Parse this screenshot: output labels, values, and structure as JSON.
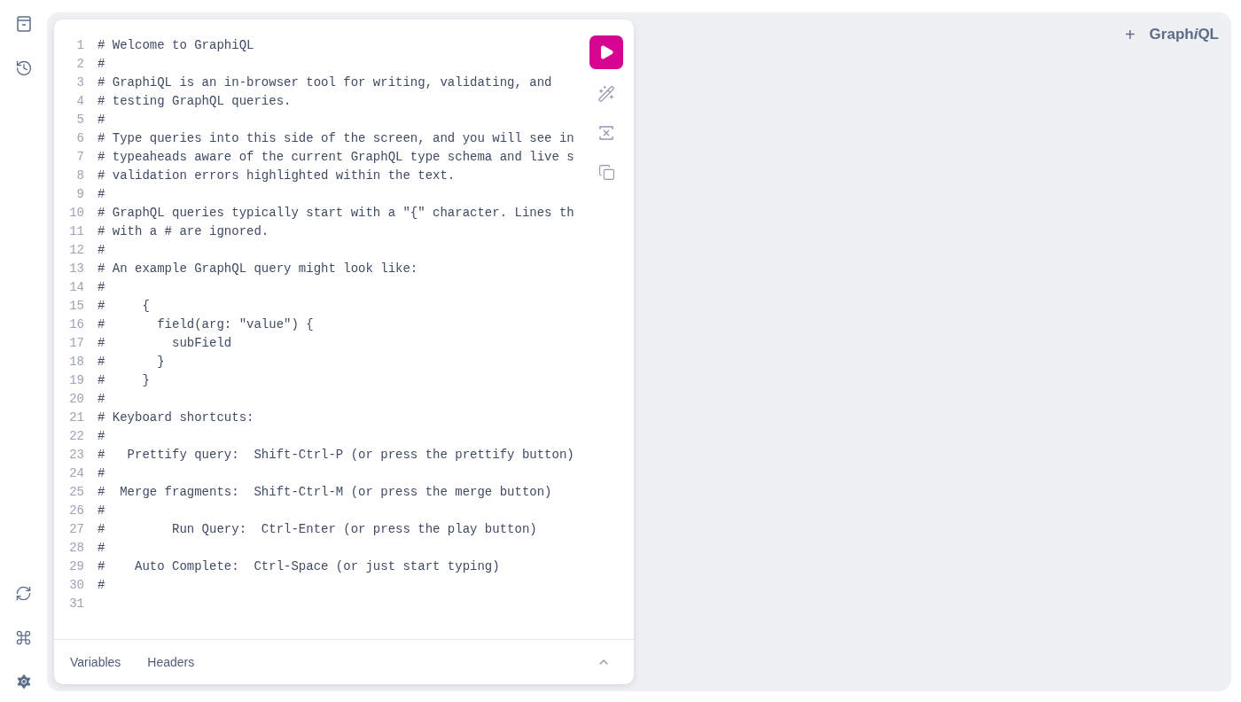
{
  "logo": [
    {
      "text": "Graph",
      "italic": false
    },
    {
      "text": "i",
      "italic": true
    },
    {
      "text": "QL",
      "italic": false
    }
  ],
  "add_tab_button": "+",
  "editor": {
    "lines": [
      {
        "number": "1",
        "text": "# Welcome to GraphiQL"
      },
      {
        "number": "2",
        "text": "#"
      },
      {
        "number": "3",
        "text": "# GraphiQL is an in-browser tool for writing, validating, and"
      },
      {
        "number": "4",
        "text": "# testing GraphQL queries."
      },
      {
        "number": "5",
        "text": "#"
      },
      {
        "number": "6",
        "text": "# Type queries into this side of the screen, and you will see in"
      },
      {
        "number": "7",
        "text": "# typeaheads aware of the current GraphQL type schema and live s"
      },
      {
        "number": "8",
        "text": "# validation errors highlighted within the text."
      },
      {
        "number": "9",
        "text": "#"
      },
      {
        "number": "10",
        "text": "# GraphQL queries typically start with a \"{\" character. Lines th"
      },
      {
        "number": "11",
        "text": "# with a # are ignored."
      },
      {
        "number": "12",
        "text": "#"
      },
      {
        "number": "13",
        "text": "# An example GraphQL query might look like:"
      },
      {
        "number": "14",
        "text": "#"
      },
      {
        "number": "15",
        "text": "#     {"
      },
      {
        "number": "16",
        "text": "#       field(arg: \"value\") {"
      },
      {
        "number": "17",
        "text": "#         subField"
      },
      {
        "number": "18",
        "text": "#       }"
      },
      {
        "number": "19",
        "text": "#     }"
      },
      {
        "number": "20",
        "text": "#"
      },
      {
        "number": "21",
        "text": "# Keyboard shortcuts:"
      },
      {
        "number": "22",
        "text": "#"
      },
      {
        "number": "23",
        "text": "#   Prettify query:  Shift-Ctrl-P (or press the prettify button)"
      },
      {
        "number": "24",
        "text": "#"
      },
      {
        "number": "25",
        "text": "#  Merge fragments:  Shift-Ctrl-M (or press the merge button)"
      },
      {
        "number": "26",
        "text": "#"
      },
      {
        "number": "27",
        "text": "#         Run Query:  Ctrl-Enter (or press the play button)"
      },
      {
        "number": "28",
        "text": "#"
      },
      {
        "number": "29",
        "text": "#    Auto Complete:  Ctrl-Space (or just start typing)"
      },
      {
        "number": "30",
        "text": "#"
      },
      {
        "number": "31"
      }
    ]
  },
  "bottom_tabs": [
    {
      "label": "Variables",
      "selected": false
    },
    {
      "label": "Headers",
      "selected": false
    }
  ]
}
